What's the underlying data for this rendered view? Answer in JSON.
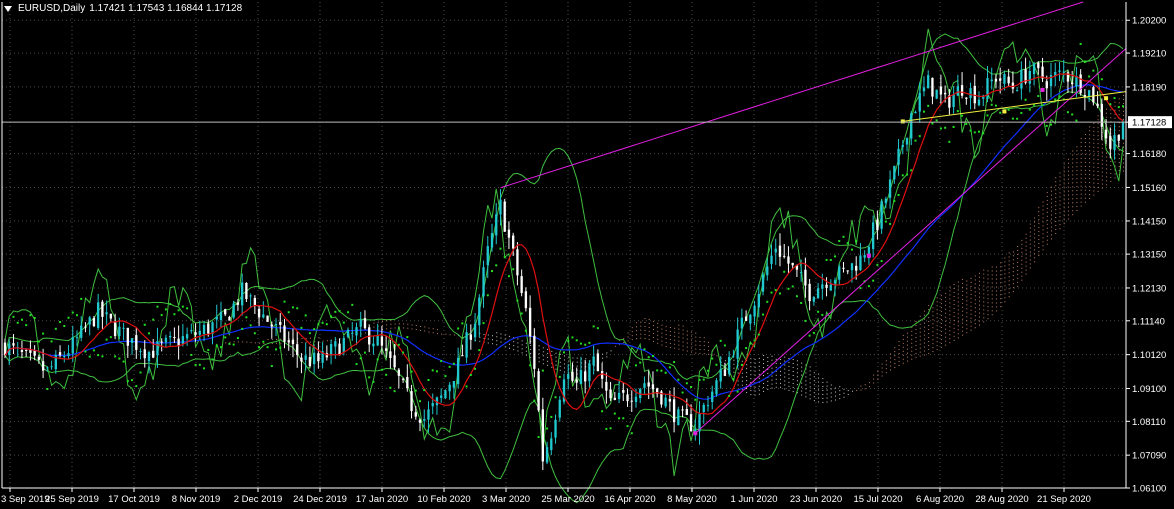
{
  "header": {
    "symbol": "EURUSD,Daily",
    "ohlc": "1.17421 1.17543 1.16844 1.17128"
  },
  "colors": {
    "background": "#000000",
    "grid": "#4a4a4a",
    "bull_candle": "#20c8d0",
    "bear_candle": "#ffffff",
    "bands": "#3fbf3f",
    "ma_red": "#e01010",
    "ma_blue": "#1030ff",
    "sar": "#22e022",
    "trend_magenta": "#e020e0",
    "trend_yellow": "#f0f040",
    "cloud_up": "#ffffff",
    "cloud_down": "#f4a080",
    "current_price_label_bg": "#ffffff"
  },
  "chart_data": {
    "type": "candlestick",
    "current_price": "1.17128",
    "price_axis": {
      "labels": [
        "1.20200",
        "1.19210",
        "1.18190",
        "1.17128",
        "1.16180",
        "1.15160",
        "1.14150",
        "1.13150",
        "1.12130",
        "1.11140",
        "1.10120",
        "1.09100",
        "1.08110",
        "1.07090",
        "1.06100"
      ],
      "range": [
        1.061,
        1.2075
      ]
    },
    "date_axis": {
      "labels": [
        "3 Sep 2019",
        "25 Sep 2019",
        "17 Oct 2019",
        "8 Nov 2019",
        "2 Dec 2019",
        "24 Dec 2019",
        "17 Jan 2020",
        "10 Feb 2020",
        "3 Mar 2020",
        "25 Mar 2020",
        "16 Apr 2020",
        "8 May 2020",
        "1 Jun 2020",
        "23 Jun 2020",
        "15 Jul 2020",
        "6 Aug 2020",
        "28 Aug 2020",
        "21 Sep 2020"
      ]
    },
    "series_path": [
      [
        0,
        1.104
      ],
      [
        5,
        1.1
      ],
      [
        10,
        1.096
      ],
      [
        16,
        1.104
      ],
      [
        22,
        1.114
      ],
      [
        28,
        1.107
      ],
      [
        34,
        1.102
      ],
      [
        40,
        1.105
      ],
      [
        46,
        1.108
      ],
      [
        52,
        1.112
      ],
      [
        56,
        1.12
      ],
      [
        61,
        1.113
      ],
      [
        66,
        1.106
      ],
      [
        70,
        1.1
      ],
      [
        74,
        1.099
      ],
      [
        78,
        1.103
      ],
      [
        84,
        1.109
      ],
      [
        88,
        1.105
      ],
      [
        92,
        1.096
      ],
      [
        96,
        1.086
      ],
      [
        99,
        1.082
      ],
      [
        103,
        1.088
      ],
      [
        107,
        1.098
      ],
      [
        111,
        1.112
      ],
      [
        114,
        1.132
      ],
      [
        117,
        1.146
      ],
      [
        120,
        1.131
      ],
      [
        123,
        1.114
      ],
      [
        125,
        1.098
      ],
      [
        127,
        1.07
      ],
      [
        129,
        1.078
      ],
      [
        132,
        1.096
      ],
      [
        135,
        1.092
      ],
      [
        139,
        1.099
      ],
      [
        143,
        1.086
      ],
      [
        147,
        1.089
      ],
      [
        151,
        1.093
      ],
      [
        155,
        1.089
      ],
      [
        159,
        1.082
      ],
      [
        163,
        1.08
      ],
      [
        166,
        1.088
      ],
      [
        170,
        1.097
      ],
      [
        174,
        1.11
      ],
      [
        178,
        1.121
      ],
      [
        182,
        1.134
      ],
      [
        186,
        1.127
      ],
      [
        190,
        1.12
      ],
      [
        194,
        1.124
      ],
      [
        198,
        1.126
      ],
      [
        202,
        1.13
      ],
      [
        206,
        1.141
      ],
      [
        210,
        1.156
      ],
      [
        214,
        1.174
      ],
      [
        218,
        1.183
      ],
      [
        222,
        1.177
      ],
      [
        226,
        1.182
      ],
      [
        230,
        1.179
      ],
      [
        234,
        1.185
      ],
      [
        238,
        1.182
      ],
      [
        242,
        1.187
      ],
      [
        246,
        1.184
      ],
      [
        250,
        1.186
      ],
      [
        254,
        1.183
      ],
      [
        257,
        1.179
      ],
      [
        261,
        1.164
      ],
      [
        264,
        1.171
      ]
    ],
    "candles_approx_count": 265
  },
  "icons": {
    "dropdown": "triangle-down-icon"
  }
}
